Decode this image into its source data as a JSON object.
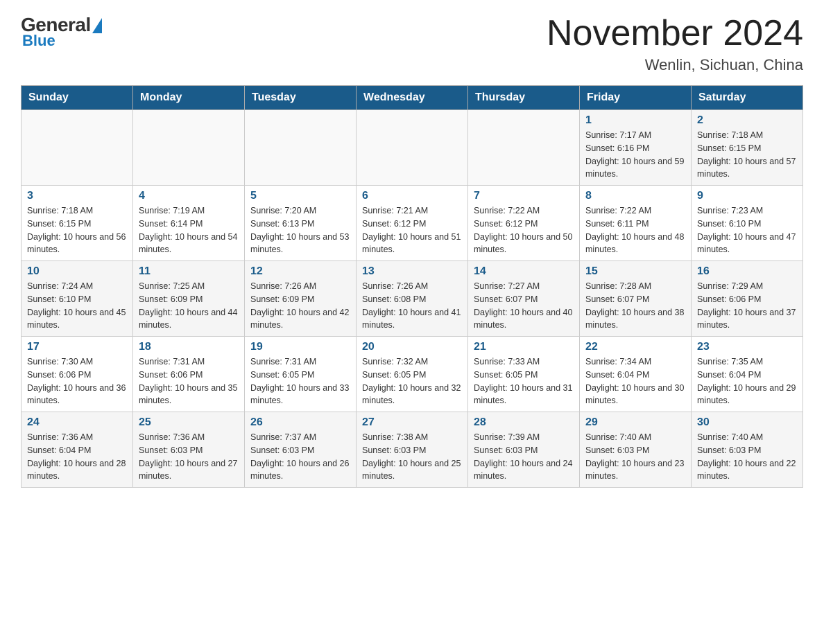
{
  "header": {
    "logo": {
      "general_text": "General",
      "blue_text": "Blue"
    },
    "title": "November 2024",
    "location": "Wenlin, Sichuan, China"
  },
  "days_of_week": [
    "Sunday",
    "Monday",
    "Tuesday",
    "Wednesday",
    "Thursday",
    "Friday",
    "Saturday"
  ],
  "weeks": [
    [
      {
        "day": "",
        "info": ""
      },
      {
        "day": "",
        "info": ""
      },
      {
        "day": "",
        "info": ""
      },
      {
        "day": "",
        "info": ""
      },
      {
        "day": "",
        "info": ""
      },
      {
        "day": "1",
        "info": "Sunrise: 7:17 AM\nSunset: 6:16 PM\nDaylight: 10 hours and 59 minutes."
      },
      {
        "day": "2",
        "info": "Sunrise: 7:18 AM\nSunset: 6:15 PM\nDaylight: 10 hours and 57 minutes."
      }
    ],
    [
      {
        "day": "3",
        "info": "Sunrise: 7:18 AM\nSunset: 6:15 PM\nDaylight: 10 hours and 56 minutes."
      },
      {
        "day": "4",
        "info": "Sunrise: 7:19 AM\nSunset: 6:14 PM\nDaylight: 10 hours and 54 minutes."
      },
      {
        "day": "5",
        "info": "Sunrise: 7:20 AM\nSunset: 6:13 PM\nDaylight: 10 hours and 53 minutes."
      },
      {
        "day": "6",
        "info": "Sunrise: 7:21 AM\nSunset: 6:12 PM\nDaylight: 10 hours and 51 minutes."
      },
      {
        "day": "7",
        "info": "Sunrise: 7:22 AM\nSunset: 6:12 PM\nDaylight: 10 hours and 50 minutes."
      },
      {
        "day": "8",
        "info": "Sunrise: 7:22 AM\nSunset: 6:11 PM\nDaylight: 10 hours and 48 minutes."
      },
      {
        "day": "9",
        "info": "Sunrise: 7:23 AM\nSunset: 6:10 PM\nDaylight: 10 hours and 47 minutes."
      }
    ],
    [
      {
        "day": "10",
        "info": "Sunrise: 7:24 AM\nSunset: 6:10 PM\nDaylight: 10 hours and 45 minutes."
      },
      {
        "day": "11",
        "info": "Sunrise: 7:25 AM\nSunset: 6:09 PM\nDaylight: 10 hours and 44 minutes."
      },
      {
        "day": "12",
        "info": "Sunrise: 7:26 AM\nSunset: 6:09 PM\nDaylight: 10 hours and 42 minutes."
      },
      {
        "day": "13",
        "info": "Sunrise: 7:26 AM\nSunset: 6:08 PM\nDaylight: 10 hours and 41 minutes."
      },
      {
        "day": "14",
        "info": "Sunrise: 7:27 AM\nSunset: 6:07 PM\nDaylight: 10 hours and 40 minutes."
      },
      {
        "day": "15",
        "info": "Sunrise: 7:28 AM\nSunset: 6:07 PM\nDaylight: 10 hours and 38 minutes."
      },
      {
        "day": "16",
        "info": "Sunrise: 7:29 AM\nSunset: 6:06 PM\nDaylight: 10 hours and 37 minutes."
      }
    ],
    [
      {
        "day": "17",
        "info": "Sunrise: 7:30 AM\nSunset: 6:06 PM\nDaylight: 10 hours and 36 minutes."
      },
      {
        "day": "18",
        "info": "Sunrise: 7:31 AM\nSunset: 6:06 PM\nDaylight: 10 hours and 35 minutes."
      },
      {
        "day": "19",
        "info": "Sunrise: 7:31 AM\nSunset: 6:05 PM\nDaylight: 10 hours and 33 minutes."
      },
      {
        "day": "20",
        "info": "Sunrise: 7:32 AM\nSunset: 6:05 PM\nDaylight: 10 hours and 32 minutes."
      },
      {
        "day": "21",
        "info": "Sunrise: 7:33 AM\nSunset: 6:05 PM\nDaylight: 10 hours and 31 minutes."
      },
      {
        "day": "22",
        "info": "Sunrise: 7:34 AM\nSunset: 6:04 PM\nDaylight: 10 hours and 30 minutes."
      },
      {
        "day": "23",
        "info": "Sunrise: 7:35 AM\nSunset: 6:04 PM\nDaylight: 10 hours and 29 minutes."
      }
    ],
    [
      {
        "day": "24",
        "info": "Sunrise: 7:36 AM\nSunset: 6:04 PM\nDaylight: 10 hours and 28 minutes."
      },
      {
        "day": "25",
        "info": "Sunrise: 7:36 AM\nSunset: 6:03 PM\nDaylight: 10 hours and 27 minutes."
      },
      {
        "day": "26",
        "info": "Sunrise: 7:37 AM\nSunset: 6:03 PM\nDaylight: 10 hours and 26 minutes."
      },
      {
        "day": "27",
        "info": "Sunrise: 7:38 AM\nSunset: 6:03 PM\nDaylight: 10 hours and 25 minutes."
      },
      {
        "day": "28",
        "info": "Sunrise: 7:39 AM\nSunset: 6:03 PM\nDaylight: 10 hours and 24 minutes."
      },
      {
        "day": "29",
        "info": "Sunrise: 7:40 AM\nSunset: 6:03 PM\nDaylight: 10 hours and 23 minutes."
      },
      {
        "day": "30",
        "info": "Sunrise: 7:40 AM\nSunset: 6:03 PM\nDaylight: 10 hours and 22 minutes."
      }
    ]
  ]
}
